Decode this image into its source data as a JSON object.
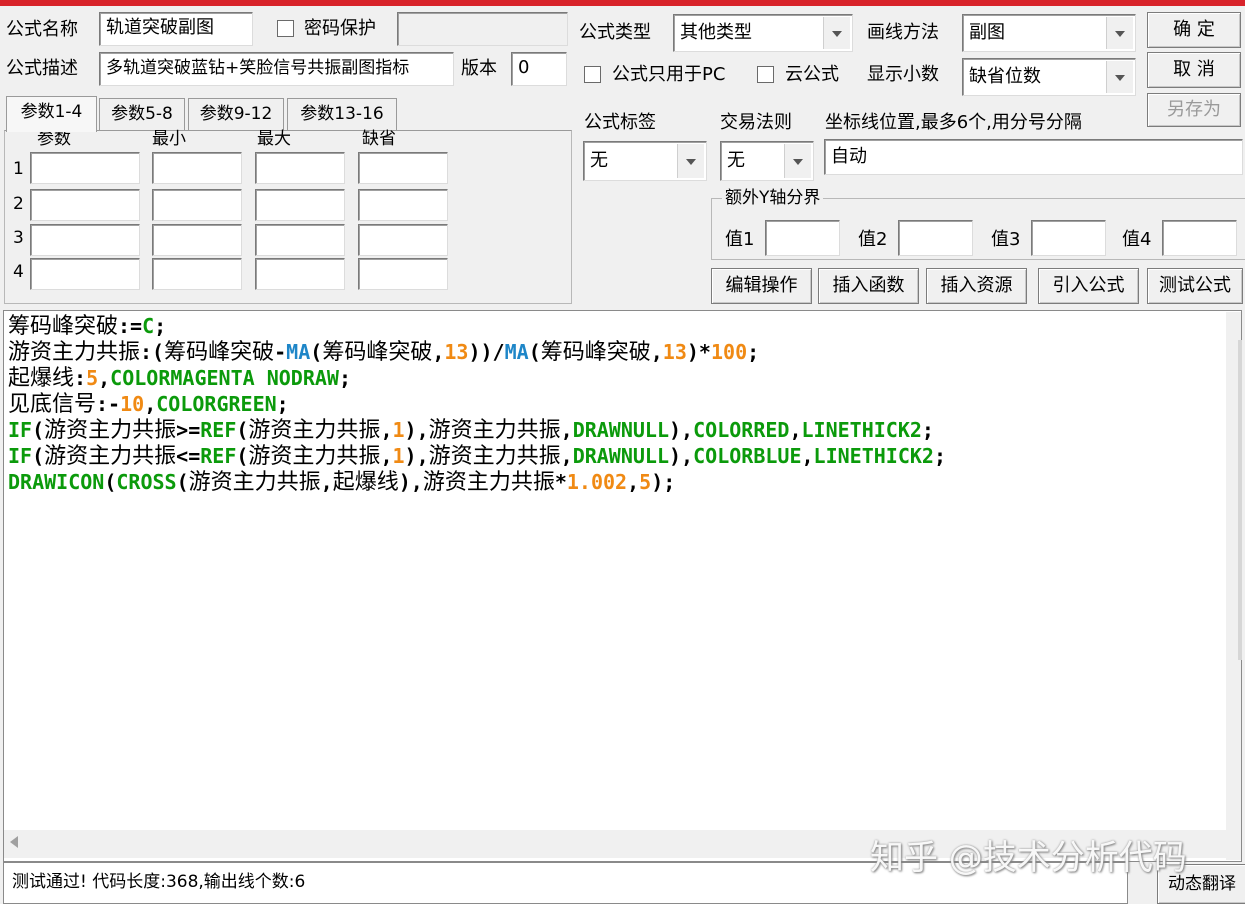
{
  "header": {
    "name_label": "公式名称",
    "name_value": "轨道突破副图",
    "password_label": "密码保护",
    "password_value": "",
    "desc_label": "公式描述",
    "desc_value": "多轨道突破蓝钻+笑脸信号共振副图指标",
    "version_label": "版本",
    "version_value": "0",
    "type_label": "公式类型",
    "type_value": "其他类型",
    "draw_label": "画线方法",
    "draw_value": "副图",
    "pc_only_label": "公式只用于PC",
    "cloud_label": "云公式",
    "decimals_label": "显示小数",
    "decimals_value": "缺省位数"
  },
  "buttons": {
    "ok": "确 定",
    "cancel": "取 消",
    "save_as": "另存为",
    "edit": "编辑操作",
    "insert_fn": "插入函数",
    "insert_res": "插入资源",
    "import": "引入公式",
    "test": "测试公式",
    "translate": "动态翻译"
  },
  "params": {
    "tabs": [
      "参数1-4",
      "参数5-8",
      "参数9-12",
      "参数13-16"
    ],
    "columns": [
      "参数",
      "最小",
      "最大",
      "缺省"
    ],
    "rows": [
      "1",
      "2",
      "3",
      "4"
    ]
  },
  "right_panel": {
    "tag_label": "公式标签",
    "tag_value": "无",
    "trade_label": "交易法则",
    "trade_value": "无",
    "axis_label": "坐标线位置,最多6个,用分号分隔",
    "axis_value": "自动",
    "extra_y_label": "额外Y轴分界",
    "values": [
      "值1",
      "值2",
      "值3",
      "值4"
    ]
  },
  "code": [
    [
      [
        "cn",
        "c-id",
        "筹码峰突破"
      ],
      [
        "m",
        "c-op",
        ":="
      ],
      [
        "m",
        "c-kw",
        "C"
      ],
      [
        "m",
        "c-op",
        ";"
      ]
    ],
    [
      [
        "cn",
        "c-id",
        "游资主力共振"
      ],
      [
        "m",
        "c-op",
        ":("
      ],
      [
        "cn",
        "c-id",
        "筹码峰突破"
      ],
      [
        "m",
        "c-op",
        "-"
      ],
      [
        "m",
        "c-fn",
        "MA"
      ],
      [
        "m",
        "c-op",
        "("
      ],
      [
        "cn",
        "c-id",
        "筹码峰突破"
      ],
      [
        "m",
        "c-op",
        ","
      ],
      [
        "m",
        "c-num",
        "13"
      ],
      [
        "m",
        "c-op",
        "))/"
      ],
      [
        "m",
        "c-fn",
        "MA"
      ],
      [
        "m",
        "c-op",
        "("
      ],
      [
        "cn",
        "c-id",
        "筹码峰突破"
      ],
      [
        "m",
        "c-op",
        ","
      ],
      [
        "m",
        "c-num",
        "13"
      ],
      [
        "m",
        "c-op",
        ")*"
      ],
      [
        "m",
        "c-num",
        "100"
      ],
      [
        "m",
        "c-op",
        ";"
      ]
    ],
    [
      [
        "cn",
        "c-id",
        "起爆线"
      ],
      [
        "m",
        "c-op",
        ":"
      ],
      [
        "m",
        "c-num",
        "5"
      ],
      [
        "m",
        "c-op",
        ","
      ],
      [
        "m",
        "c-kw",
        "COLORMAGENTA NODRAW"
      ],
      [
        "m",
        "c-op",
        ";"
      ]
    ],
    [
      [
        "cn",
        "c-id",
        "见底信号"
      ],
      [
        "m",
        "c-op",
        ":-"
      ],
      [
        "m",
        "c-num",
        "10"
      ],
      [
        "m",
        "c-op",
        ","
      ],
      [
        "m",
        "c-kw",
        "COLORGREEN"
      ],
      [
        "m",
        "c-op",
        ";"
      ]
    ],
    [
      [
        "m",
        "c-kw",
        "IF"
      ],
      [
        "m",
        "c-op",
        "("
      ],
      [
        "cn",
        "c-id",
        "游资主力共振"
      ],
      [
        "m",
        "c-op",
        ">="
      ],
      [
        "m",
        "c-kw",
        "REF"
      ],
      [
        "m",
        "c-op",
        "("
      ],
      [
        "cn",
        "c-id",
        "游资主力共振"
      ],
      [
        "m",
        "c-op",
        ","
      ],
      [
        "m",
        "c-num",
        "1"
      ],
      [
        "m",
        "c-op",
        "),"
      ],
      [
        "cn",
        "c-id",
        "游资主力共振"
      ],
      [
        "m",
        "c-op",
        ","
      ],
      [
        "m",
        "c-kw",
        "DRAWNULL"
      ],
      [
        "m",
        "c-op",
        "),"
      ],
      [
        "m",
        "c-kw",
        "COLORRED"
      ],
      [
        "m",
        "c-op",
        ","
      ],
      [
        "m",
        "c-kw",
        "LINETHICK2"
      ],
      [
        "m",
        "c-op",
        ";"
      ]
    ],
    [
      [
        "m",
        "c-kw",
        "IF"
      ],
      [
        "m",
        "c-op",
        "("
      ],
      [
        "cn",
        "c-id",
        "游资主力共振"
      ],
      [
        "m",
        "c-op",
        "<="
      ],
      [
        "m",
        "c-kw",
        "REF"
      ],
      [
        "m",
        "c-op",
        "("
      ],
      [
        "cn",
        "c-id",
        "游资主力共振"
      ],
      [
        "m",
        "c-op",
        ","
      ],
      [
        "m",
        "c-num",
        "1"
      ],
      [
        "m",
        "c-op",
        "),"
      ],
      [
        "cn",
        "c-id",
        "游资主力共振"
      ],
      [
        "m",
        "c-op",
        ","
      ],
      [
        "m",
        "c-kw",
        "DRAWNULL"
      ],
      [
        "m",
        "c-op",
        "),"
      ],
      [
        "m",
        "c-kw",
        "COLORBLUE"
      ],
      [
        "m",
        "c-op",
        ","
      ],
      [
        "m",
        "c-kw",
        "LINETHICK2"
      ],
      [
        "m",
        "c-op",
        ";"
      ]
    ],
    [
      [
        "m",
        "c-kw",
        "DRAWICON"
      ],
      [
        "m",
        "c-op",
        "("
      ],
      [
        "m",
        "c-kw",
        "CROSS"
      ],
      [
        "m",
        "c-op",
        "("
      ],
      [
        "cn",
        "c-id",
        "游资主力共振"
      ],
      [
        "m",
        "c-op",
        ","
      ],
      [
        "cn",
        "c-id",
        "起爆线"
      ],
      [
        "m",
        "c-op",
        "),"
      ],
      [
        "cn",
        "c-id",
        "游资主力共振"
      ],
      [
        "m",
        "c-op",
        "*"
      ],
      [
        "m",
        "c-num",
        "1.002"
      ],
      [
        "m",
        "c-op",
        ","
      ],
      [
        "m",
        "c-num",
        "5"
      ],
      [
        "m",
        "c-op",
        ");"
      ]
    ]
  ],
  "status": {
    "text": "测试通过! 代码长度:368,输出线个数:6"
  },
  "watermark": "知乎 @技术分析代码"
}
